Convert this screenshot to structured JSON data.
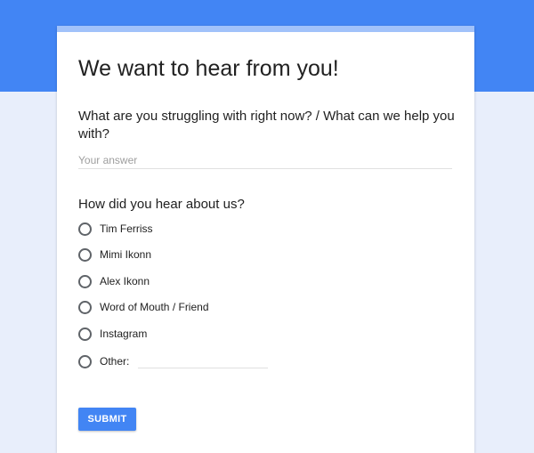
{
  "form": {
    "title": "We want to hear from you!",
    "question1": {
      "text": "What are you struggling with right now? / What can we help you with?",
      "placeholder": "Your answer",
      "value": ""
    },
    "question2": {
      "text": "How did you hear about us?",
      "options": [
        {
          "label": "Tim Ferriss",
          "selected": false
        },
        {
          "label": "Mimi Ikonn",
          "selected": false
        },
        {
          "label": "Alex Ikonn",
          "selected": false
        },
        {
          "label": "Word of Mouth / Friend",
          "selected": false
        },
        {
          "label": "Instagram",
          "selected": false
        },
        {
          "label": "Other:",
          "selected": false
        }
      ]
    },
    "submit_label": "SUBMIT"
  },
  "colors": {
    "header": "#4285f4",
    "accent_strip": "#a1c2fa",
    "background": "#e8eefb",
    "button": "#4285f4"
  }
}
